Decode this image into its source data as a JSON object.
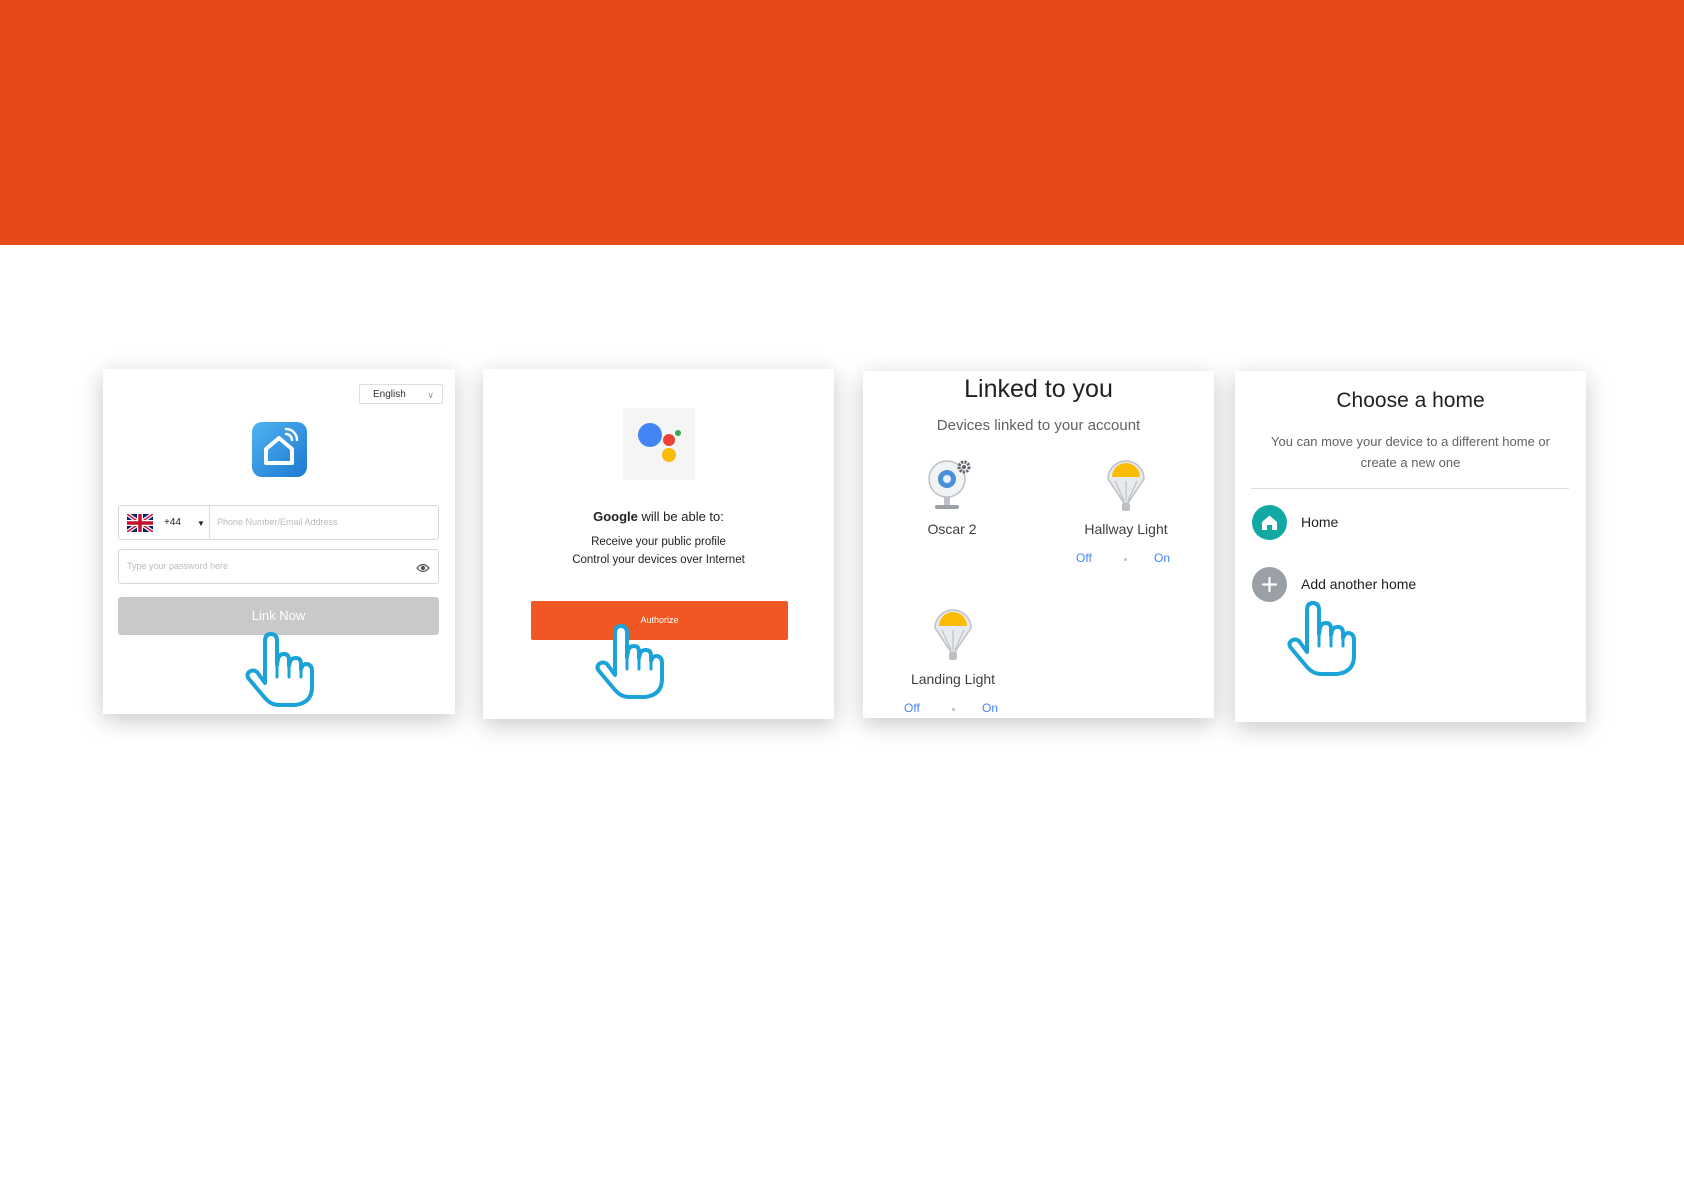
{
  "colors": {
    "banner": "#E64A19",
    "authorize_button": "#F05722",
    "link_button": "#C9C9C9",
    "toggle_text": "#4285F4",
    "home_icon": "#12A9A4",
    "add_icon": "#9AA0A6",
    "hand_outline": "#1AA3D9"
  },
  "panel_link": {
    "language": "English",
    "country_code": "+44",
    "phone_placeholder": "Phone Number/Email Address",
    "password_placeholder": "Type your password here",
    "link_button": "Link Now"
  },
  "panel_google": {
    "title_brand": "Google",
    "title_rest": " will be able to:",
    "permissions": [
      "Receive your public profile",
      "Control your devices over Internet"
    ],
    "authorize_button": "Authorize"
  },
  "panel_linked": {
    "title": "Linked to you",
    "subtitle": "Devices linked to your account",
    "devices": [
      {
        "name": "Oscar 2",
        "icon": "camera-icon"
      },
      {
        "name": "Hallway Light",
        "icon": "bulb-icon",
        "off": "Off",
        "on": "On"
      },
      {
        "name": "Landing Light",
        "icon": "bulb-icon",
        "off": "Off",
        "on": "On"
      }
    ]
  },
  "panel_home": {
    "title": "Choose a home",
    "subtitle": "You can move your device to a different home or create a new one",
    "items": [
      {
        "label": "Home",
        "icon": "home-icon"
      },
      {
        "label": "Add another home",
        "icon": "plus-icon"
      }
    ]
  }
}
